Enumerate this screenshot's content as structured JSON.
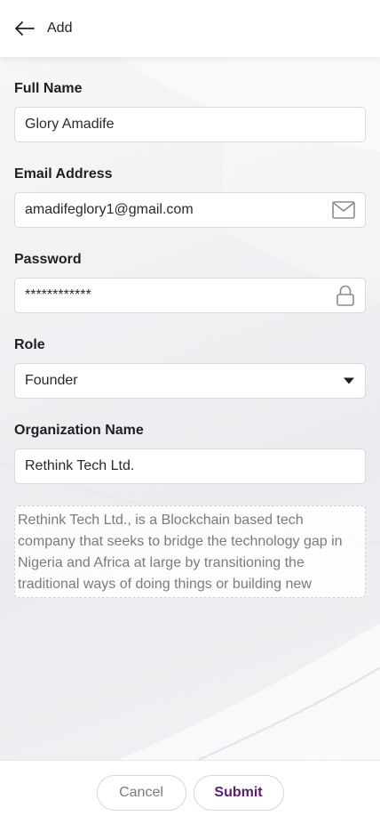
{
  "header": {
    "title": "Add",
    "back_icon": "arrow-left-icon"
  },
  "form": {
    "full_name": {
      "label": "Full Name",
      "value": "Glory Amadife"
    },
    "email": {
      "label": "Email Address",
      "value": "amadifeglory1@gmail.com",
      "icon": "envelope-icon"
    },
    "password": {
      "label": "Password",
      "value": "************",
      "icon": "lock-icon"
    },
    "role": {
      "label": "Role",
      "value": "Founder",
      "icon": "caret-down-icon"
    },
    "organization": {
      "label": "Organization Name",
      "value": "Rethink Tech Ltd."
    },
    "description": {
      "value": "Rethink Tech Ltd., is a Blockchain based tech company that seeks to bridge the technology gap in Nigeria and Africa at large by transitioning the traditional ways of doing things or building new"
    }
  },
  "footer": {
    "cancel_label": "Cancel",
    "submit_label": "Submit"
  },
  "colors": {
    "accent": "#5b1e6b",
    "background": "#f1f1f4",
    "border": "#d9d9de"
  }
}
